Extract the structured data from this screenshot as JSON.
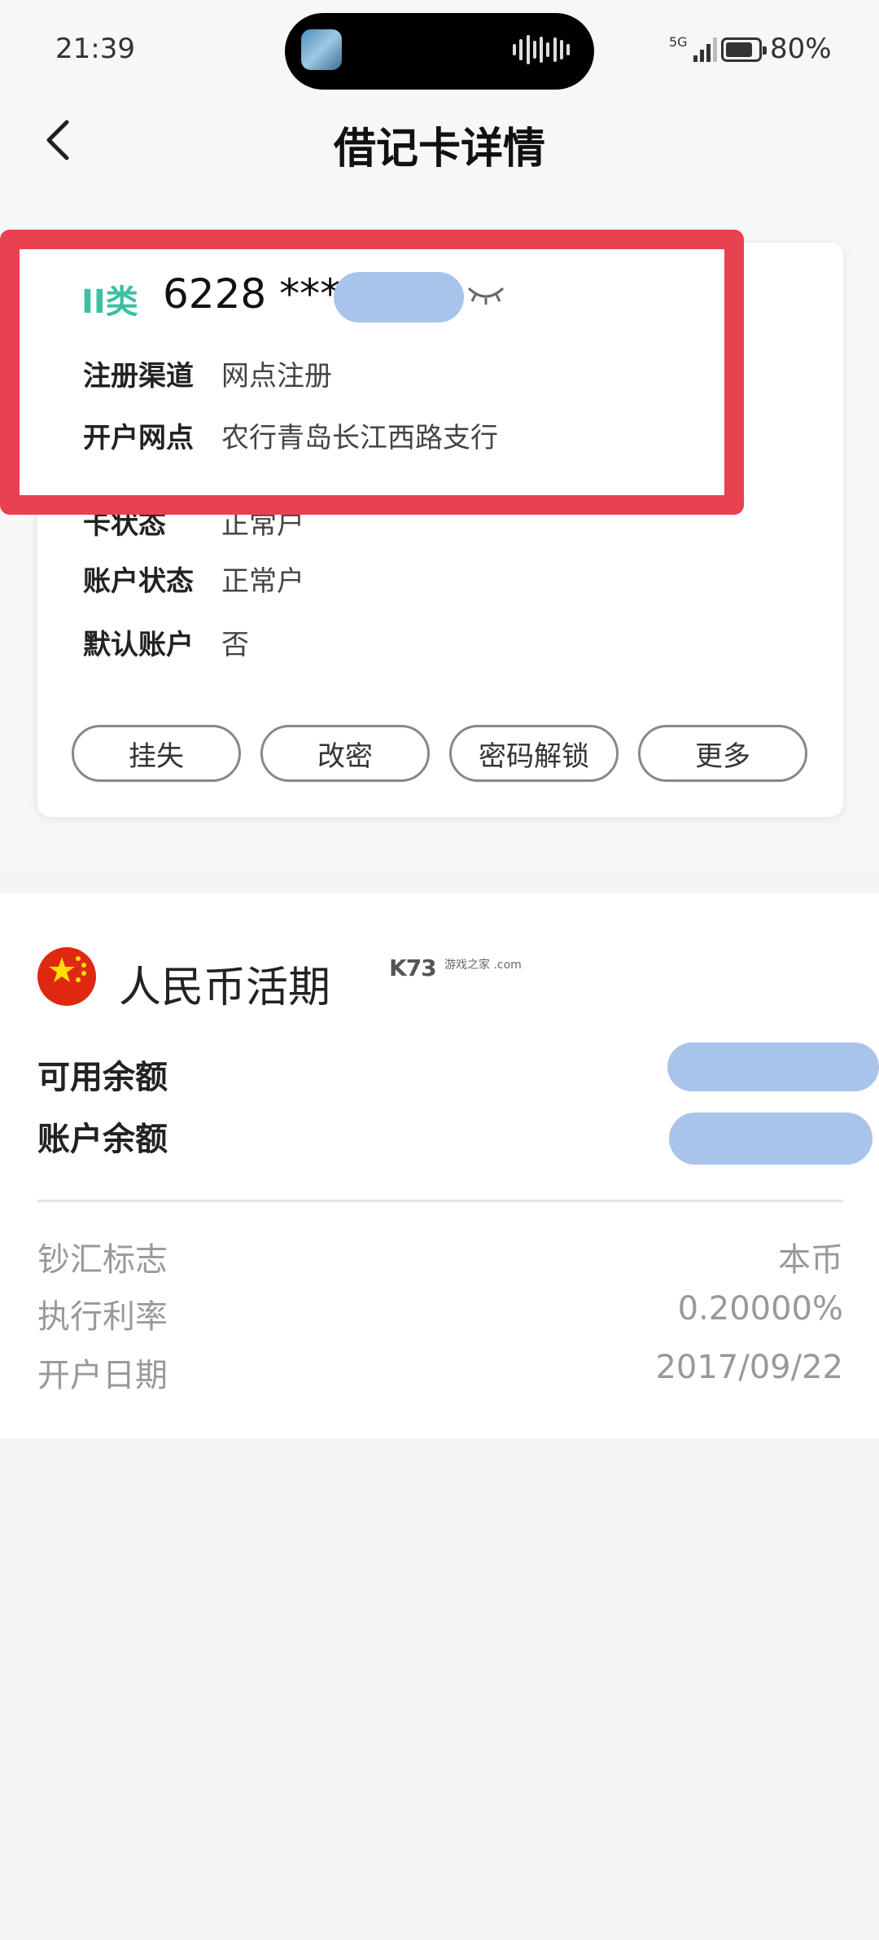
{
  "status_bar": {
    "time": "21:39",
    "network": "5G",
    "battery": "80%"
  },
  "header": {
    "title": "借记卡详情",
    "back_icon": "chevron-left-icon"
  },
  "card": {
    "type_badge": "II类",
    "card_number": "6228 ****",
    "eye_icon": "eye-closed-icon",
    "fields": [
      {
        "label": "注册渠道",
        "value": "网点注册"
      },
      {
        "label": "开户网点",
        "value": "农行青岛长江西路支行"
      },
      {
        "label": "卡状态",
        "value": "正常户"
      },
      {
        "label": "账户状态",
        "value": "正常户"
      },
      {
        "label": "默认账户",
        "value": "否"
      }
    ],
    "actions": [
      "挂失",
      "改密",
      "密码解锁",
      "更多"
    ]
  },
  "account": {
    "flag_icon": "china-flag-icon",
    "title": "人民币活期",
    "watermark": "K73",
    "watermark_sub": "游戏之家 .com",
    "balances": [
      {
        "label": "可用余额"
      },
      {
        "label": "账户余额"
      }
    ],
    "details": [
      {
        "label": "钞汇标志",
        "value": "本币"
      },
      {
        "label": "执行利率",
        "value": "0.20000%"
      },
      {
        "label": "开户日期",
        "value": "2017/09/22"
      }
    ]
  },
  "colors": {
    "accent_teal": "#3dbfa0",
    "highlight_red": "#e8414f",
    "redaction_blue": "#a9c4ea"
  }
}
